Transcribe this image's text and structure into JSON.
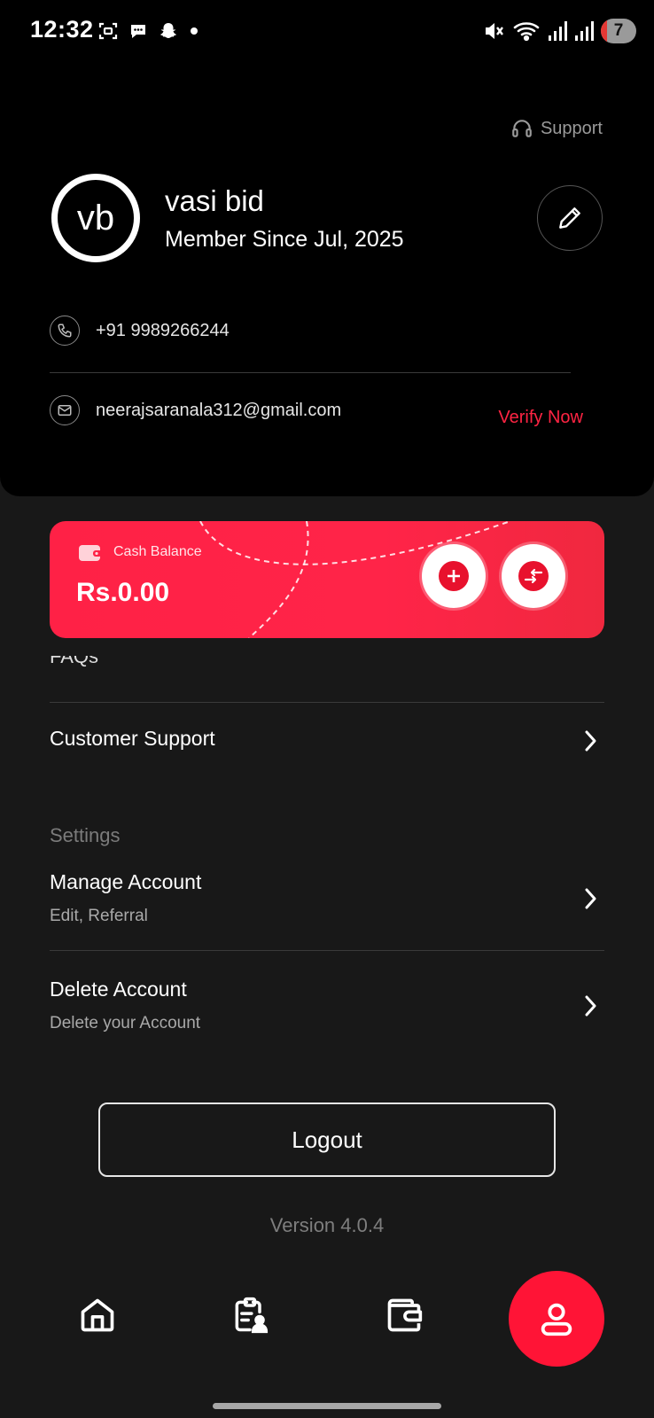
{
  "status_bar": {
    "time": "12:32",
    "battery_level": "7",
    "icons_left": [
      "screenshot-icon",
      "chat-icon",
      "snapchat-icon",
      "dot-icon"
    ],
    "icons_right": [
      "mute-icon",
      "wifi-icon",
      "signal-icon",
      "signal-icon",
      "battery-icon"
    ]
  },
  "header": {
    "support_label": "Support",
    "avatar_initials": "vb",
    "name": "vasi bid",
    "member_since": "Member Since Jul, 2025",
    "phone": "+91 9989266244",
    "email": "neerajsaranala312@gmail.com",
    "verify_label": "Verify Now"
  },
  "balance_card": {
    "label": "Cash Balance",
    "amount": "Rs.0.00",
    "actions": [
      "add-money-icon",
      "transfer-icon"
    ]
  },
  "menu": {
    "faded_item": "FAQs",
    "customer_support": "Customer Support",
    "settings_heading": "Settings",
    "manage_account": {
      "title": "Manage Account",
      "subtitle": "Edit, Referral"
    },
    "delete_account": {
      "title": "Delete Account",
      "subtitle": "Delete your Account"
    }
  },
  "logout_label": "Logout",
  "version": "Version 4.0.4",
  "bottom_nav": {
    "items": [
      "home-icon",
      "contests-icon",
      "wallet-icon",
      "profile-icon"
    ],
    "active": "profile-icon"
  },
  "colors": {
    "accent": "#ff1436",
    "header_bg": "#000000",
    "page_bg": "#181818",
    "muted_text": "#7b7b7b"
  }
}
